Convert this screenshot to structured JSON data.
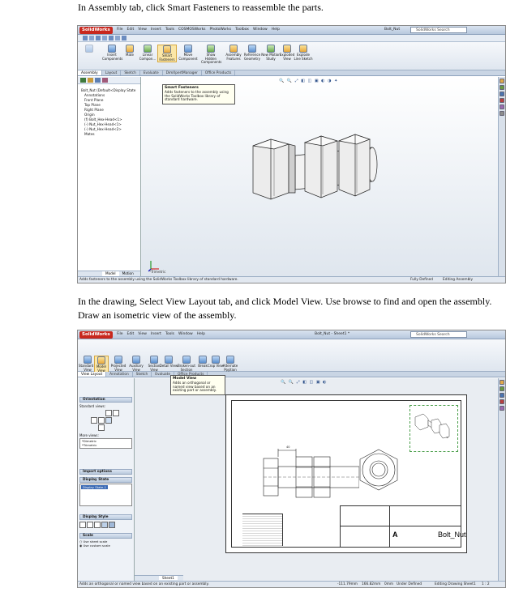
{
  "instructions": {
    "step1": "In Assembly tab, click Smart Fasteners to reassemble the parts.",
    "step2": "In the drawing, Select View Layout tab, and click Model View. Use browse to find and open the assembly. Draw an isometric view of the assembly."
  },
  "screen1": {
    "app_name": "SolidWorks",
    "menu": [
      "File",
      "Edit",
      "View",
      "Insert",
      "Tools",
      "COSMOSWorks",
      "PhotoWorks",
      "Toolbox",
      "Window",
      "Help"
    ],
    "doc_title": "Bolt_Nut",
    "search_placeholder": "SolidWorks Search",
    "commands": [
      "Insert Components",
      "Mate",
      "Linear Compon...",
      "Smart Fasteners",
      "Move Component",
      "Show Hidden Components",
      "Assembly Features",
      "Reference Geometry",
      "New Motion Study",
      "Exploded View",
      "Explode Line Sketch"
    ],
    "tabs": [
      "Assembly",
      "Layout",
      "Sketch",
      "Evaluate",
      "DimXpertManager",
      "Office Products"
    ],
    "active_tab": "Assembly",
    "tree": [
      "Bolt_Nut (Default<Display State",
      "Annotations",
      "Front Plane",
      "Top Plane",
      "Right Plane",
      "Origin",
      "(f) Bolt_Hex-Head<1>",
      "(-) Nut_Hex-Head<1>",
      "(-) Nut_Hex-Head<2>",
      "Mates"
    ],
    "tooltip_title": "Smart Fasteners",
    "tooltip_body": "Adds fasteners to the assembly using the SolidWorks Toolbox library of standard hardware.",
    "bottom_tabs": [
      "Model",
      "Motion Study 1"
    ],
    "status_left": "Adds fasteners to the assembly using the SolidWorks Toolbox library of standard hardware.",
    "status_mid": "Fully Defined",
    "status_right": "Editing Assembly",
    "view_label": "*Trimetric"
  },
  "screen2": {
    "app_name": "SolidWorks",
    "menu": [
      "File",
      "Edit",
      "View",
      "Insert",
      "Tools",
      "Window",
      "Help"
    ],
    "doc_title": "Bolt_Nut - Sheet1 *",
    "search_placeholder": "SolidWorks Search",
    "commands": [
      "Standard 3 View",
      "Model View",
      "Projected View",
      "Auxiliary View",
      "Section View",
      "Detail View",
      "Broken-out Section",
      "Break",
      "Crop View",
      "Alternate Position View"
    ],
    "tabs": [
      "View Layout",
      "Annotation",
      "Sketch",
      "Evaluate",
      "Office Products"
    ],
    "active_tab": "View Layout",
    "tooltip_title": "Model View",
    "tooltip_body": "Adds an orthogonal or named view based on an existing part or assembly.",
    "pm": {
      "orientation": "Orientation",
      "standard_views": "Standard views:",
      "more_views": "More views:",
      "more_items": [
        "*Dimetric",
        "*Trimetric"
      ],
      "import_options": "Import options",
      "display_state": "Display State",
      "display_state_item": "Display State-1",
      "display_style": "Display Style",
      "scale": "Scale",
      "scale_opts": [
        "Use sheet scale",
        "Use custom scale"
      ]
    },
    "sheet_tab": "Sheet1",
    "title_block_name": "Bolt_Nut",
    "title_block_size": "A",
    "dim_label": "40",
    "status_left": "Adds an orthogonal or named view based on an existing part or assembly.",
    "status_coords": [
      "-111.79mm",
      "166.82mm",
      "0mm"
    ],
    "status_mid": "Under Defined",
    "status_right": "Editing Drawing Sheet1",
    "status_scale": "1 : 2"
  }
}
